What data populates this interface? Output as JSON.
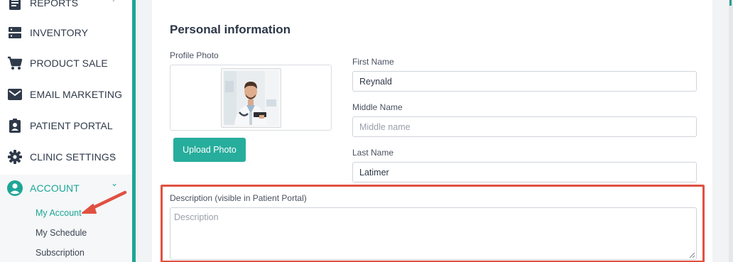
{
  "sidebar": {
    "items": [
      {
        "label": "REPORTS",
        "icon": "report-icon",
        "has_chevron": true
      },
      {
        "label": "INVENTORY",
        "icon": "inventory-icon",
        "has_chevron": false
      },
      {
        "label": "PRODUCT SALE",
        "icon": "cart-icon",
        "has_chevron": false
      },
      {
        "label": "EMAIL MARKETING",
        "icon": "mail-icon",
        "has_chevron": false
      },
      {
        "label": "PATIENT PORTAL",
        "icon": "portal-icon",
        "has_chevron": false
      },
      {
        "label": "CLINIC SETTINGS",
        "icon": "gear-icon",
        "has_chevron": true
      },
      {
        "label": "ACCOUNT",
        "icon": "account-icon",
        "has_chevron": true,
        "active": true
      }
    ],
    "chevron_right": "›",
    "chevron_down": "⌄",
    "account_sub": [
      {
        "label": "My Account",
        "active": true
      },
      {
        "label": "My Schedule"
      },
      {
        "label": "Subscription"
      }
    ]
  },
  "main": {
    "section_title": "Personal information",
    "profile_photo_label": "Profile Photo",
    "upload_button": "Upload Photo",
    "first_name": {
      "label": "First Name",
      "value": "Reynald",
      "placeholder": ""
    },
    "middle_name": {
      "label": "Middle Name",
      "value": "",
      "placeholder": "Middle name"
    },
    "last_name": {
      "label": "Last Name",
      "value": "Latimer",
      "placeholder": ""
    },
    "description": {
      "label": "Description (visible in Patient Portal)",
      "value": "",
      "placeholder": "Description"
    }
  },
  "colors": {
    "accent": "#1ea597",
    "highlight": "#e05141",
    "text": "#2f3a4a"
  }
}
